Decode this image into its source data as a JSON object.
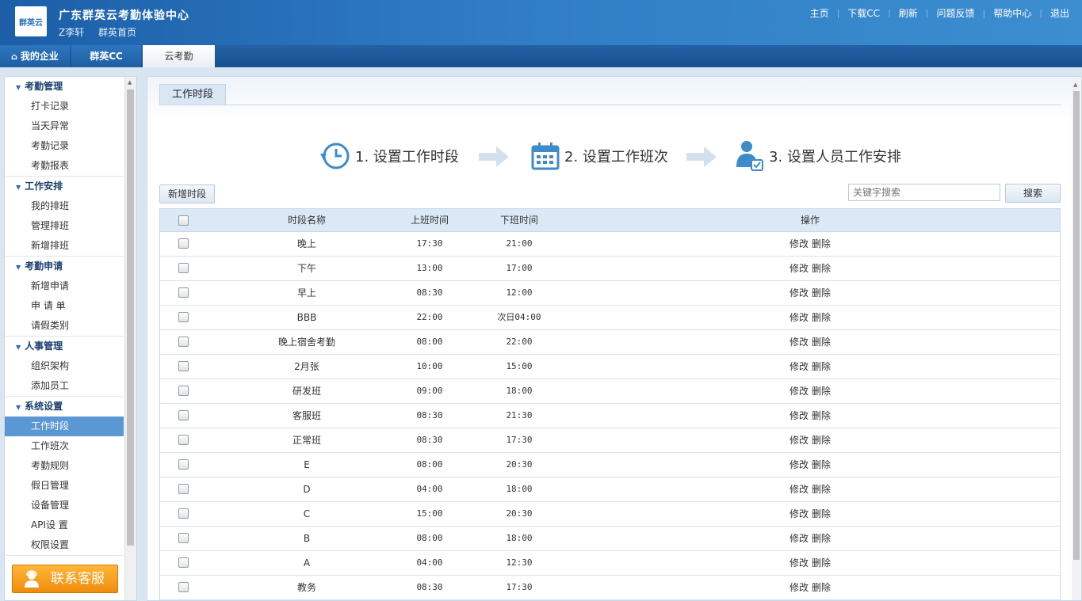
{
  "header": {
    "logo_text": "群英云",
    "title": "广东群英云考勤体验中心",
    "user_name": "Z李轩",
    "home_link": "群英首页",
    "nav": [
      "主页",
      "下载CC",
      "刷新",
      "问题反馈",
      "帮助中心",
      "退出"
    ]
  },
  "tabs": {
    "home": "我的企业",
    "cc": "群英CC",
    "active": "云考勤"
  },
  "sidebar": {
    "groups": [
      {
        "title": "考勤管理",
        "items": [
          "打卡记录",
          "当天异常",
          "考勤记录",
          "考勤报表"
        ]
      },
      {
        "title": "工作安排",
        "items": [
          "我的排班",
          "管理排班",
          "新增排班"
        ]
      },
      {
        "title": "考勤申请",
        "items": [
          "新增申请",
          "申 请 单",
          "请假类别"
        ]
      },
      {
        "title": "人事管理",
        "items": [
          "组织架构",
          "添加员工"
        ]
      },
      {
        "title": "系统设置",
        "items": [
          "工作时段",
          "工作班次",
          "考勤规则",
          "假日管理",
          "设备管理",
          "API设 置",
          "权限设置"
        ]
      }
    ],
    "active_item": "工作时段",
    "contact_label": "联系客服"
  },
  "main": {
    "panel_title": "工作时段",
    "steps": [
      "1. 设置工作时段",
      "2. 设置工作班次",
      "3. 设置人员工作安排"
    ],
    "add_button": "新增时段",
    "search_placeholder": "关键字搜索",
    "search_button": "搜索",
    "columns": [
      "时段名称",
      "上班时间",
      "下班时间",
      "操作"
    ],
    "edit_label": "修改",
    "delete_label": "删除",
    "rows": [
      {
        "name": "晚上",
        "start": "17:30",
        "end": "21:00"
      },
      {
        "name": "下午",
        "start": "13:00",
        "end": "17:00"
      },
      {
        "name": "早上",
        "start": "08:30",
        "end": "12:00"
      },
      {
        "name": "BBB",
        "start": "22:00",
        "end": "次日04:00"
      },
      {
        "name": "晚上宿舍考勤",
        "start": "08:00",
        "end": "22:00"
      },
      {
        "name": "2月张",
        "start": "10:00",
        "end": "15:00"
      },
      {
        "name": "研发班",
        "start": "09:00",
        "end": "18:00"
      },
      {
        "name": "客服班",
        "start": "08:30",
        "end": "21:30"
      },
      {
        "name": "正常班",
        "start": "08:30",
        "end": "17:30"
      },
      {
        "name": "E",
        "start": "08:00",
        "end": "20:30"
      },
      {
        "name": "D",
        "start": "04:00",
        "end": "18:00"
      },
      {
        "name": "C",
        "start": "15:00",
        "end": "20:30"
      },
      {
        "name": "B",
        "start": "08:00",
        "end": "18:00"
      },
      {
        "name": "A",
        "start": "04:00",
        "end": "12:30"
      },
      {
        "name": "教务",
        "start": "08:30",
        "end": "17:30"
      }
    ]
  },
  "colors": {
    "header": "#2f7cc4",
    "active_item": "#5b97d3",
    "contact": "#f5a01f",
    "step_icon": "#3d8bcb"
  }
}
